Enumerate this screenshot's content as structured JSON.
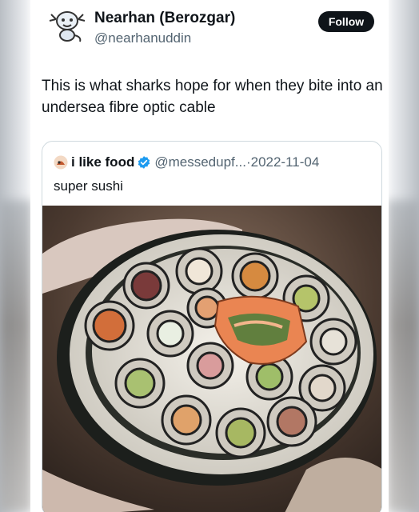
{
  "tweet": {
    "author_name": "Nearhan (Berozgar)",
    "author_handle": "@nearhanuddin",
    "follow_label": "Follow",
    "text": "This is what sharks hope for when they bite into an undersea fibre optic cable"
  },
  "quoted": {
    "author_name": "i like food",
    "author_handle": "@messedupf...",
    "separator": "·",
    "date": "2022-11-04",
    "text": "super sushi",
    "verified_color": "#1d9bf0"
  },
  "icons": {
    "avatar": "cartoon-character-avatar",
    "quoted_avatar": "food-avatar",
    "verified": "verified-badge-icon"
  }
}
